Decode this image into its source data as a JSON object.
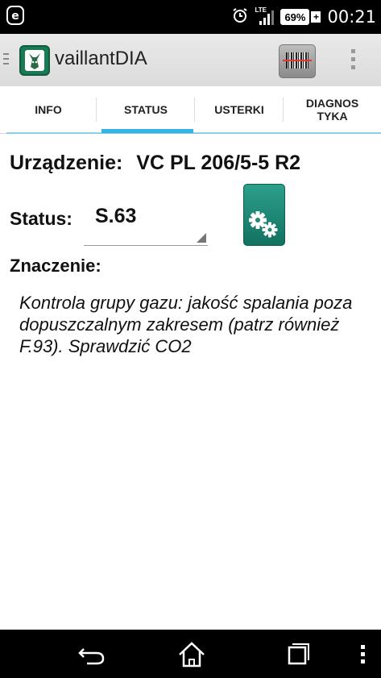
{
  "status_bar": {
    "network": "LTE",
    "battery": "69%",
    "time": "00:21"
  },
  "action_bar": {
    "title": "vaillantDIA",
    "icons": [
      "drawer-icon",
      "app-logo-icon",
      "barcode-scan-icon",
      "overflow-menu-icon"
    ]
  },
  "tabs": [
    {
      "label": "INFO",
      "active": false
    },
    {
      "label": "STATUS",
      "active": true
    },
    {
      "label": "USTERKI",
      "active": false
    },
    {
      "label": "DIAGNOS TYKA",
      "active": false,
      "line1": "DIAGNOS",
      "line2": "TYKA"
    }
  ],
  "content": {
    "device_label": "Urządzenie:",
    "device_value": "VC PL 206/5-5 R2",
    "status_label": "Status:",
    "status_value": "S.63",
    "meaning_label": "Znaczenie:",
    "meaning_text": "Kontrola grupy gazu: jakość spalania poza dopuszczalnym zakresem (patrz również F.93). Sprawdzić CO2"
  },
  "colors": {
    "accent": "#33b5e5",
    "gear_button": "#1e8a76"
  },
  "nav_bar": {
    "icons": [
      "back-icon",
      "home-icon",
      "recents-icon",
      "menu-icon"
    ]
  }
}
